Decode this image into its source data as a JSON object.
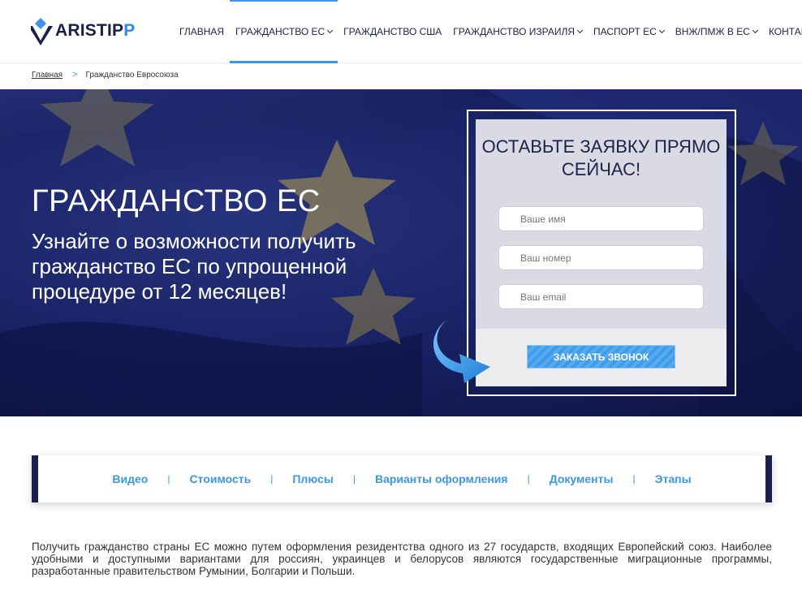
{
  "brand": {
    "logo_main": "ARISTIP",
    "logo_accent": "P",
    "colors": {
      "navy": "#1d2247",
      "accent": "#3d95e8"
    }
  },
  "nav": {
    "items": [
      {
        "label": "ГЛАВНАЯ",
        "dropdown": false
      },
      {
        "label": "ГРАЖДАНСТВО ЕС",
        "dropdown": true,
        "active": true
      },
      {
        "label": "ГРАЖДАНСТВО США",
        "dropdown": false
      },
      {
        "label": "ГРАЖДАНСТВО ИЗРАИЛЯ",
        "dropdown": true
      },
      {
        "label": "ПАСПОРТ ЕС",
        "dropdown": true
      },
      {
        "label": "ВНЖ/ПМЖ В ЕС",
        "dropdown": true
      },
      {
        "label": "КОНТАКТЫ",
        "dropdown": false
      }
    ]
  },
  "breadcrumb": {
    "home": "Главная",
    "separator": ">",
    "current": "Гражданство Евросоюза"
  },
  "hero": {
    "title": "ГРАЖДАНСТВО ЕС",
    "subtitle": "Узнайте о возможности получить гражданство ЕС по упрощенной процедуре от 12 месяцев!"
  },
  "form": {
    "title": "ОСТАВЬТЕ ЗАЯВКУ ПРЯМО СЕЙЧАС!",
    "name_placeholder": "Ваше имя",
    "phone_placeholder": "Ваш номер",
    "email_placeholder": "Ваш email",
    "submit_label": "ЗАКАЗАТЬ ЗВОНОК"
  },
  "tabs": {
    "items": [
      "Видео",
      "Стоимость",
      "Плюсы",
      "Варианты оформления",
      "Документы",
      "Этапы"
    ],
    "separator": "|"
  },
  "intro_text": "Получить гражданство страны ЕС можно путем оформления резидентства одного из 27 государств, входящих Европейский союз. Наиболее удобными и доступными вариантами для россиян, украинцев и белорусов являются государственные миграционные программы, разработанные правительством Румынии, Болгарии и Польши."
}
